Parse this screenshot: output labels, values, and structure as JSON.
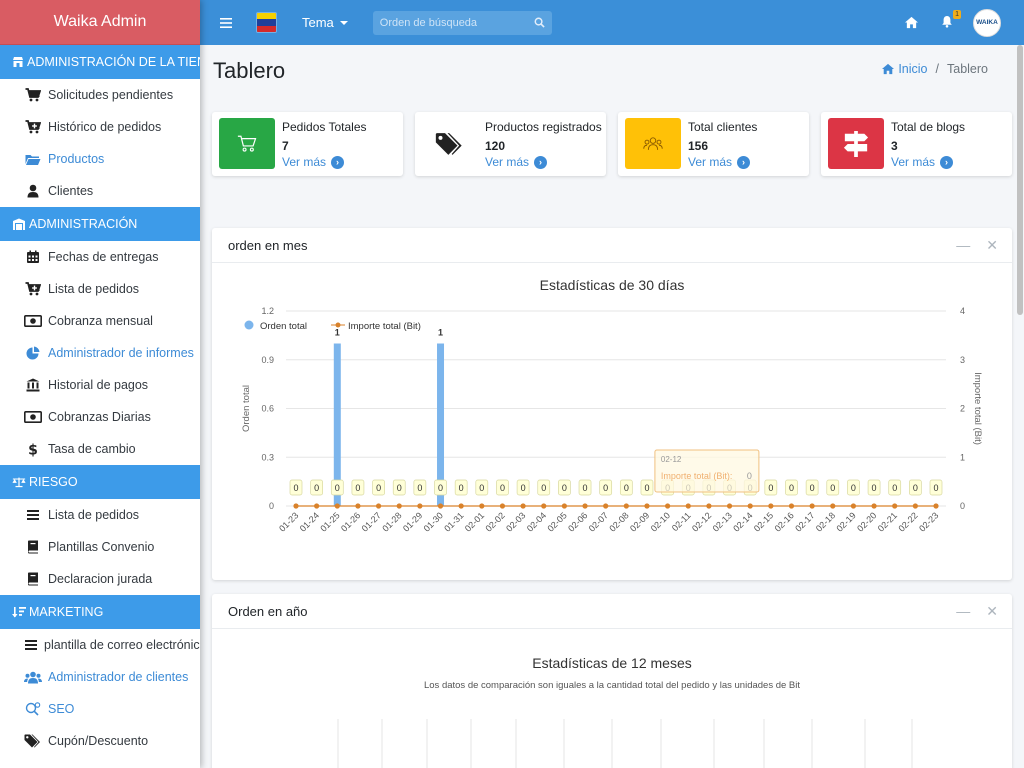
{
  "brand": "Waika Admin",
  "sidebar": {
    "sections": [
      {
        "title": "ADMINISTRACIÓN DE LA TIENDA",
        "icon": "store-icon",
        "items": [
          {
            "label": "Solicitudes pendientes",
            "icon": "cart-icon",
            "active": false
          },
          {
            "label": "Histórico de pedidos",
            "icon": "cart-plus-icon",
            "active": false
          },
          {
            "label": "Productos",
            "icon": "folder-open-icon",
            "active": true
          },
          {
            "label": "Clientes",
            "icon": "user-icon",
            "active": false
          }
        ]
      },
      {
        "title": "ADMINISTRACIÓN",
        "icon": "warehouse-icon",
        "items": [
          {
            "label": "Fechas de entregas",
            "icon": "calendar-icon",
            "active": false
          },
          {
            "label": "Lista de pedidos",
            "icon": "cart-plus-icon",
            "active": false
          },
          {
            "label": "Cobranza mensual",
            "icon": "money-bill-icon",
            "active": false
          },
          {
            "label": "Administrador de informes",
            "icon": "pie-chart-icon",
            "active": true
          },
          {
            "label": "Historial de pagos",
            "icon": "bank-icon",
            "active": false
          },
          {
            "label": "Cobranzas Diarias",
            "icon": "money-bill-icon",
            "active": false
          },
          {
            "label": "Tasa de cambio",
            "icon": "dollar-icon",
            "active": false
          }
        ]
      },
      {
        "title": "RIESGO",
        "icon": "balance-scale-icon",
        "items": [
          {
            "label": "Lista de pedidos",
            "icon": "list-icon",
            "active": false
          },
          {
            "label": "Plantillas Convenio",
            "icon": "book-icon",
            "active": false
          },
          {
            "label": "Declaracion jurada",
            "icon": "book-icon",
            "active": false
          }
        ]
      },
      {
        "title": "MARKETING",
        "icon": "sort-amount-icon",
        "items": [
          {
            "label": "plantilla de correo electrónico",
            "icon": "list-icon",
            "active": false
          },
          {
            "label": "Administrador de clientes",
            "icon": "users-icon",
            "active": true
          },
          {
            "label": "SEO",
            "icon": "seo-icon",
            "active": true
          },
          {
            "label": "Cupón/Descuento",
            "icon": "tags-icon",
            "active": false
          }
        ]
      }
    ]
  },
  "topbar": {
    "theme_label": "Tema",
    "search_placeholder": "Orden de búsqueda",
    "notification_count": "1",
    "avatar_text": "WAIKA"
  },
  "page": {
    "title": "Tablero",
    "breadcrumb": {
      "home": "Inicio",
      "current": "Tablero"
    }
  },
  "cards": [
    {
      "title": "Pedidos Totales",
      "value": "7",
      "more": "Ver más",
      "color": "#28a745",
      "icon": "cart-icon"
    },
    {
      "title": "Productos registrados",
      "value": "120",
      "more": "Ver más",
      "color": "#ffffff",
      "icon": "tags-icon"
    },
    {
      "title": "Total clientes",
      "value": "156",
      "more": "Ver más",
      "color": "#ffc107",
      "icon": "users-icon"
    },
    {
      "title": "Total de blogs",
      "value": "3",
      "more": "Ver más",
      "color": "#dc3545",
      "icon": "signs-icon"
    }
  ],
  "panels": {
    "month": {
      "title": "orden en mes"
    },
    "year": {
      "title": "Orden en año",
      "chart_title": "Estadísticas de 12 meses",
      "chart_subtitle": "Los datos de comparación son iguales a la cantidad total del pedido y las unidades de Bit"
    }
  },
  "chart_data": {
    "type": "bar",
    "title": "Estadísticas de 30 días",
    "categories": [
      "01-23",
      "01-24",
      "01-25",
      "01-26",
      "01-27",
      "01-28",
      "01-29",
      "01-30",
      "01-31",
      "02-01",
      "02-02",
      "02-03",
      "02-04",
      "02-05",
      "02-06",
      "02-07",
      "02-08",
      "02-09",
      "02-10",
      "02-11",
      "02-12",
      "02-13",
      "02-14",
      "02-15",
      "02-16",
      "02-17",
      "02-18",
      "02-19",
      "02-20",
      "02-21",
      "02-22",
      "02-23"
    ],
    "series": [
      {
        "name": "Orden total",
        "type": "bar",
        "axis": "left",
        "color": "#7cb5ec",
        "values": [
          0,
          0,
          1,
          0,
          0,
          0,
          0,
          1,
          0,
          0,
          0,
          0,
          0,
          0,
          0,
          0,
          0,
          0,
          0,
          0,
          0,
          0,
          0,
          0,
          0,
          0,
          0,
          0,
          0,
          0,
          0,
          0
        ]
      },
      {
        "name": "Importe total (Bit)",
        "type": "line",
        "axis": "right",
        "color": "#d9822b",
        "values": [
          0,
          0,
          0,
          0,
          0,
          0,
          0,
          0,
          0,
          0,
          0,
          0,
          0,
          0,
          0,
          0,
          0,
          0,
          0,
          0,
          0,
          0,
          0,
          0,
          0,
          0,
          0,
          0,
          0,
          0,
          0,
          0
        ]
      }
    ],
    "ylabel": "Orden total",
    "y2label": "Importe total (Bit)",
    "ylim": [
      0,
      1.2
    ],
    "y2lim": [
      0,
      4
    ],
    "yticks": [
      "0",
      "0.3",
      "0.6",
      "0.9",
      "1.2"
    ],
    "y2ticks": [
      "0",
      "1",
      "2",
      "3",
      "4"
    ],
    "legend": "top-left",
    "tooltip": {
      "category": "02-12",
      "label": "Importe total (Bit):",
      "value": "0"
    }
  }
}
